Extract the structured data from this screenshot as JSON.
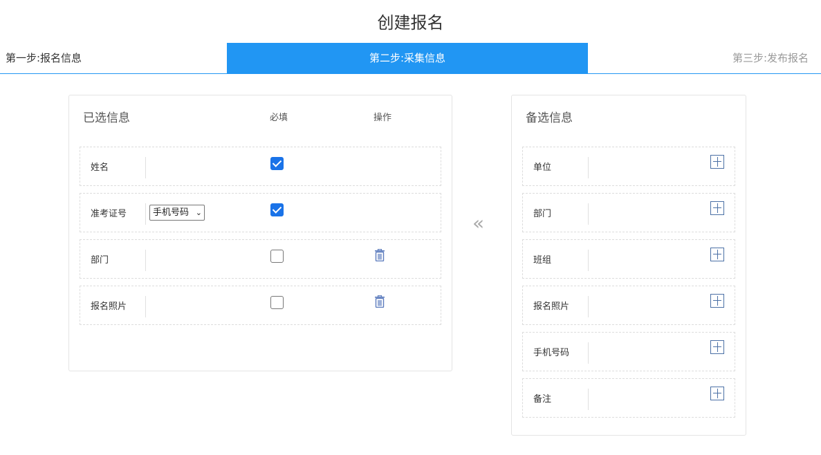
{
  "page": {
    "title": "创建报名"
  },
  "steps": {
    "step1": "第一步:报名信息",
    "step2": "第二步:采集信息",
    "step3": "第三步:发布报名",
    "active_color": "#2196f3"
  },
  "selected": {
    "title": "已选信息",
    "col_required": "必填",
    "col_action": "操作",
    "rows": [
      {
        "label": "姓名",
        "required": true,
        "deletable": false
      },
      {
        "label": "准考证号",
        "required": true,
        "deletable": false,
        "select_value": "手机号码"
      },
      {
        "label": "部门",
        "required": false,
        "deletable": true
      },
      {
        "label": "报名照片",
        "required": false,
        "deletable": true
      }
    ]
  },
  "available": {
    "title": "备选信息",
    "rows": [
      {
        "label": "单位"
      },
      {
        "label": "部门"
      },
      {
        "label": "班组"
      },
      {
        "label": "报名照片"
      },
      {
        "label": "手机号码"
      },
      {
        "label": "备注"
      }
    ]
  },
  "icons": {
    "move_left": "double-chevron-left-icon",
    "delete": "trash-icon",
    "add": "plus-square-icon"
  }
}
